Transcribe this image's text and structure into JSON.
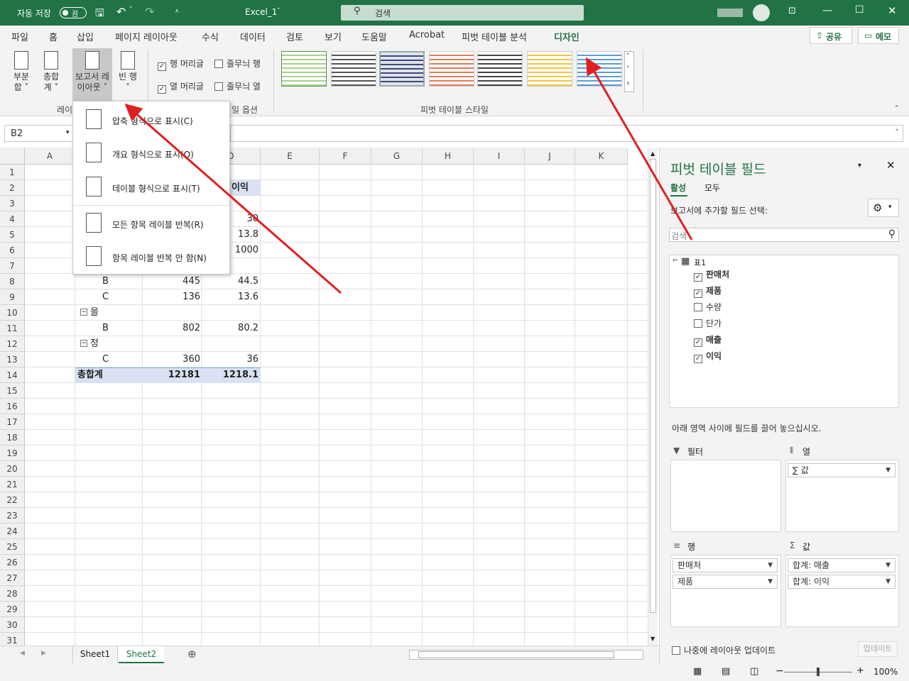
{
  "titlebar": {
    "autosave": "자동 저장",
    "toggle": "끔",
    "filename": "Excel_1",
    "search": "검색"
  },
  "tabs": [
    "파일",
    "홈",
    "삽입",
    "페이지 레이아웃",
    "수식",
    "데이터",
    "검토",
    "보기",
    "도움말",
    "Acrobat",
    "피벗 테이블 분석",
    "디자인"
  ],
  "share": "공유",
  "memo": "메모",
  "ribbon": {
    "subtotal": [
      "부분",
      "합 ˅"
    ],
    "grandtotal": [
      "총합",
      "계 ˅"
    ],
    "reportlayout": [
      "보고서 레",
      "이아웃 ˅"
    ],
    "blankrows": [
      "빈 행",
      "˅"
    ],
    "row_headers": "행 머리글",
    "banded_rows": "줄무늬 행",
    "col_headers": "열 머리글",
    "banded_cols": "줄무늬 열",
    "layout_group": "레이",
    "options_group": "일 옵션",
    "styles_group": "피벗 테이블 스타일"
  },
  "namebox": "B2",
  "columns": [
    "A",
    "B",
    "C",
    "D",
    "E",
    "F",
    "G",
    "H",
    "I",
    "J",
    "K"
  ],
  "rows": [
    "1",
    "2",
    "3",
    "4",
    "5",
    "6",
    "7",
    "8",
    "9",
    "10",
    "11",
    "12",
    "13",
    "14",
    "15",
    "16",
    "17",
    "18",
    "19",
    "20",
    "21",
    "22",
    "23",
    "24",
    "25",
    "26",
    "27",
    "28",
    "29",
    "30",
    "31"
  ],
  "cells": {
    "d2": "이익",
    "d4": "30",
    "d5": "13.8",
    "d6": "1000",
    "b8": "B",
    "c8": "445",
    "d8": "44.5",
    "b9": "C",
    "c9": "136",
    "d9": "13.6",
    "b10": "을",
    "b11": "B",
    "c11": "802",
    "d11": "80.2",
    "b12": "정",
    "b13": "C",
    "c13": "360",
    "d13": "36",
    "b14": "총합계",
    "c14": "12181",
    "d14": "1218.1"
  },
  "dropdown": [
    "압축 형식으로 표시(C)",
    "개요 형식으로 표시(O)",
    "테이블 형식으로 표시(T)",
    "모든 항목 레이블 반복(R)",
    "항목 레이블 반복 안 함(N)"
  ],
  "sheets": [
    "Sheet1",
    "Sheet2"
  ],
  "status": {
    "zoom": "100%"
  },
  "pane": {
    "title": "피벗 테이블 필드",
    "tab_active": "활성",
    "tab_all": "모두",
    "choose": "보고서에 추가할 필드 선택:",
    "search_placeholder": "검색",
    "table": "표1",
    "fields": [
      {
        "name": "판매처",
        "checked": true
      },
      {
        "name": "제품",
        "checked": true
      },
      {
        "name": "수량",
        "checked": false
      },
      {
        "name": "단가",
        "checked": false
      },
      {
        "name": "매출",
        "checked": true
      },
      {
        "name": "이익",
        "checked": true
      }
    ],
    "drag_hint": "아래 영역 사이에 필드를 끌어 놓으십시오.",
    "filter": "필터",
    "columns": "열",
    "rows": "행",
    "values": "값",
    "col_value": "∑ 값",
    "row_fields": [
      "판매처",
      "제품"
    ],
    "value_fields": [
      "합계: 매출",
      "합계: 이익"
    ],
    "defer": "나중에 레이아웃 업데이트",
    "update": "업데이트"
  },
  "colors": {
    "accent": "#217346",
    "arrow": "#e02020"
  }
}
